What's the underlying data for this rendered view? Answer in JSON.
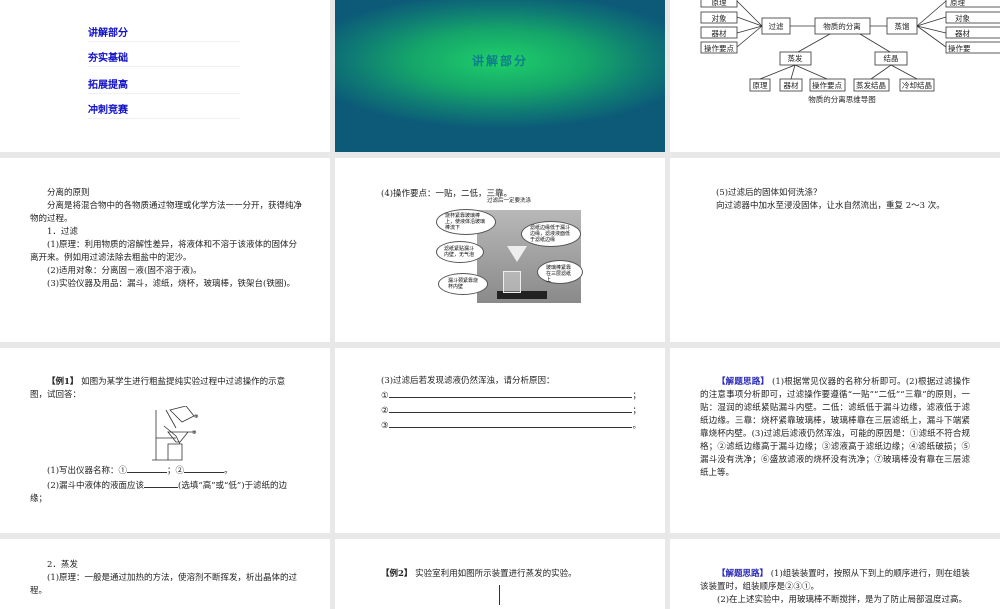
{
  "slide1": {
    "menu": [
      "讲解部分",
      "夯实基础",
      "拓展提高",
      "冲刺竞赛"
    ]
  },
  "slide2": {
    "title": "讲解部分",
    "bg_colors": [
      "#1fcf6a",
      "#0c5a78"
    ]
  },
  "slide3": {
    "left_items": [
      "原理",
      "对象",
      "器材",
      "操作要点"
    ],
    "filter": "过滤",
    "center": "物质的分离",
    "distill": "蒸馏",
    "right_items": [
      "原理",
      "对象",
      "器材",
      "操作要"
    ],
    "evaporate": "蒸发",
    "crystal": "结晶",
    "bottom_items": [
      "原理",
      "器材",
      "操作要点",
      "蒸发结晶",
      "冷却结晶"
    ],
    "caption": "物质的分离思维导图"
  },
  "slide4": {
    "lines": [
      "分离的原则",
      "分离是将混合物中的各物质通过物理或化学方法一一分开，获得纯净物的过程。",
      "1．过滤",
      "(1)原理：利用物质的溶解性差异，将液体和不溶于该液体的固体分离开来。例如用过滤法除去粗盐中的泥沙。",
      "(2)适用对象：分离固－液(固不溶于液)。",
      "(3)实验仪器及用品：漏斗，滤纸，烧杯，玻璃棒，铁架台(铁圈)。"
    ]
  },
  "slide5": {
    "heading": "(4)操作要点：一贴，二低，三靠。",
    "photo_caption": "过滤后一定要洗涤",
    "callouts": [
      "烧杯紧靠玻璃棒上，使液体沿玻璃棒流下",
      "滤纸边缘低于漏斗边缘，滤液液面低于滤纸边缘",
      "滤纸紧贴漏斗内壁，无气泡",
      "玻璃棒紧靠在三层滤纸上",
      "漏斗颈紧靠烧杯内壁"
    ]
  },
  "slide6": {
    "lines": [
      "(5)过滤后的固体如何洗涤？",
      "向过滤器中加水至浸没固体，让水自然流出，重复 2～3 次。"
    ]
  },
  "slide7": {
    "tag": "【例1】",
    "intro": "如图为某学生进行粗盐提纯实验过程中过滤操作的示意图，试回答：",
    "label1": "①",
    "label2": "②",
    "q1a": "(1)写出仪器名称：①",
    "q1b": "；②",
    "q1c": "。",
    "q2a": "(2)漏斗中液体的液面应该",
    "q2b": "(选填“高”或“低”)于滤纸的边缘；"
  },
  "slide8": {
    "q3": "(3)过滤后若发现滤液仍然浑浊，请分析原因：",
    "blanks": [
      {
        "n": "①",
        "end": "；"
      },
      {
        "n": "②",
        "end": "；"
      },
      {
        "n": "③",
        "end": "。"
      }
    ]
  },
  "slide9": {
    "tag": "【解题思路】",
    "text": "(1)根据常见仪器的名称分析即可。(2)根据过滤操作的注意事项分析即可，过滤操作要遵循“一贴”“二低”“三靠”的原则，一贴：湿润的滤纸紧贴漏斗内壁。二低：滤纸低于漏斗边缘，滤液低于滤纸边缘。三靠：烧杯紧靠玻璃棒，玻璃棒靠在三层滤纸上，漏斗下端紧靠烧杯内壁。(3)过滤后滤液仍然浑浊，可能的原因是：①滤纸不符合规格；②滤纸边缘高于漏斗边缘；③滤液高于滤纸边缘；④滤纸破损；⑤漏斗没有洗净；⑥盛放滤液的烧杯没有洗净；⑦玻璃棒没有靠在三层滤纸上等。",
    "accent": "#2a2ab8"
  },
  "slide10": {
    "lines": [
      "2．蒸发",
      "(1)原理：一般是通过加热的方法，使溶剂不断挥发，析出晶体的过程。"
    ]
  },
  "slide11": {
    "tag": "【例2】",
    "text": "实验室利用如图所示装置进行蒸发的实验。"
  },
  "slide12": {
    "tag": "【解题思路】",
    "text": "(1)组装装置时，按照从下到上的顺序进行，则在组装该装置时，组装顺序是②③①。",
    "next": "(2)在上述实验中，用玻璃棒不断搅拌，是为了防止局部温度过高。"
  }
}
